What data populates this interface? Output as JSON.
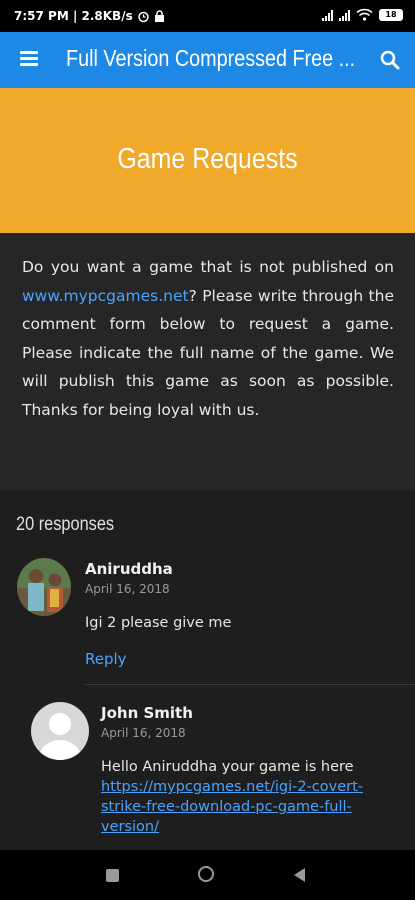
{
  "status_bar": {
    "time_speed": "7:57 PM | 2.8KB/s",
    "battery": "18"
  },
  "app_bar": {
    "title": "Full Version Compressed Free ..."
  },
  "hero": {
    "title": "Game Requests"
  },
  "article": {
    "text_before_link": "Do you want a game that is not published on ",
    "link_text": "www.mypcgames.net",
    "text_after_link": "? Please write through the comment form below to request a game. Please indicate the full name of the game. We will publish this game as soon as possible. Thanks for being loyal with us."
  },
  "comments": {
    "count_label": "20 responses",
    "items": [
      {
        "author": "Aniruddha",
        "date": "April 16, 2018",
        "text": "Igi 2 please give me",
        "reply_label": "Reply"
      },
      {
        "author": "John Smith",
        "date": "April 16, 2018",
        "text": "Hello Aniruddha your game is here",
        "link_text": "https://mypcgames.net/igi-2-covert-strike-free-download-pc-game-full-version/"
      }
    ]
  },
  "colors": {
    "app_bar": "#1e88e5",
    "hero": "#f0a92b",
    "link": "#4aa3ff",
    "background": "#222222"
  }
}
